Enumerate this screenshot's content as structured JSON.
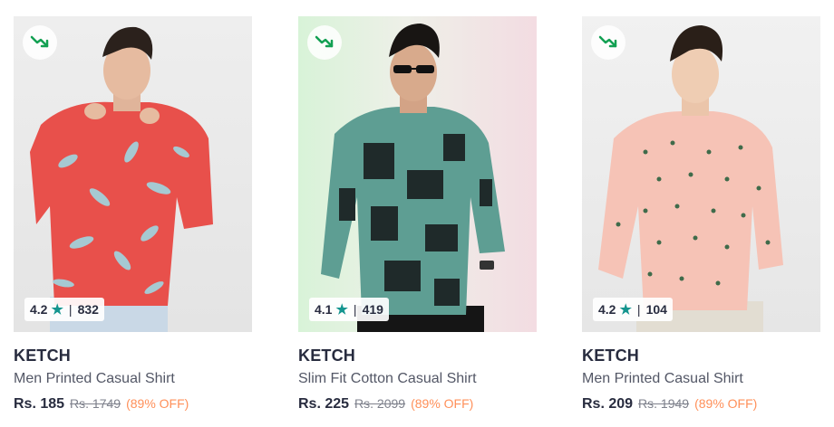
{
  "products": [
    {
      "brand": "KETCH",
      "title": "Men Printed Casual Shirt",
      "rating": "4.2",
      "rating_count": "832",
      "price": "Rs. 185",
      "mrp": "Rs. 1749",
      "discount": "(89% OFF)",
      "shirt_color": "#e8504b",
      "print_color": "#a6c9d2",
      "image_description": "man in red shirt with light blue leaf print"
    },
    {
      "brand": "KETCH",
      "title": "Slim Fit Cotton Casual Shirt",
      "rating": "4.1",
      "rating_count": "419",
      "price": "Rs. 225",
      "mrp": "Rs. 2099",
      "discount": "(89% OFF)",
      "shirt_color": "#5e9e93",
      "print_color": "#1f2a2a",
      "image_description": "man in teal and black printed shirt wearing sunglasses"
    },
    {
      "brand": "KETCH",
      "title": "Men Printed Casual Shirt",
      "rating": "4.2",
      "rating_count": "104",
      "price": "Rs. 209",
      "mrp": "Rs. 1949",
      "discount": "(89% OFF)",
      "shirt_color": "#f6c3b6",
      "print_color": "#3f6b4a",
      "image_description": "man in peach shirt with small dot print"
    }
  ],
  "colors": {
    "trend_icon": "#12a052",
    "rating_star": "#14958f",
    "discount": "#ff905a"
  },
  "icons": {
    "trend": "trending-down-icon",
    "star": "star-icon"
  }
}
